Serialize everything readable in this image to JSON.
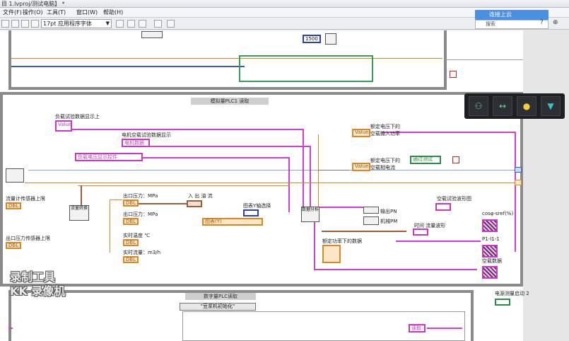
{
  "window": {
    "title": "目 1.lvproj/测试电脑】 *"
  },
  "menu": {
    "items": [
      "文件(F)",
      "操作(O)",
      "工具(T)",
      "窗口(W)",
      "帮助(H)"
    ]
  },
  "toolbar": {
    "font_select": "17pt 应用程序字体",
    "cloud_button": "连接上云",
    "help_search": "搜索",
    "window_controls": [
      "?",
      "⊕"
    ]
  },
  "top_frame": {
    "constant_value": "1500",
    "constant_color": "#2b3fb3"
  },
  "mid_frame": {
    "label": "模拟量PLC1 读取",
    "labels": {
      "load_data_display": "负载试验数据显示上",
      "motor_noload_data": "电机空载试验数据显示",
      "flowmeter_upper": "流量计传感器上限",
      "outlet_pressure_upper": "出口压力传感器上限",
      "outlet_pressure_1": "出口压力：MPa",
      "outlet_pressure_2": "出口压力：MPa",
      "realtime_temp": "实时温度 ℃",
      "realtime_flow": "实时流量：m3/h",
      "in_out_flow": "入 出 油 流",
      "chart_y_select": "图表Y轴选择",
      "rated_voltage_input": "额定电压下的",
      "noload_input_power": "空载输入功率",
      "rated_voltage_current": "额定电压下的",
      "noload_phase_current": "空载相电流",
      "noload_curve": "空载试验波形图",
      "output_power": "输出PN",
      "mech_power": "机械PM",
      "time_flow": "时间 流量波形",
      "cos_ref": "cosφ-sref(%)",
      "p1_i1": "P1-I1-1",
      "noload_data": "空载数据",
      "rated_power_data": "额定功率下的数据",
      "save_label": "保存路径",
      "analysis_node": "数据分析",
      "convert_node": "流量转换",
      "calc_node": "计算"
    },
    "controls": {
      "value_1": "Value",
      "value_2": "Value",
      "value_3": "Value",
      "load_test_ctrl": "负载电压显示控件",
      "ring_ctrl": "电机数据",
      "ring_ctrl_2": "图表(Y)",
      "bool_ctrl": "通过测试",
      "dbl": "DBL"
    }
  },
  "bottom_frame": {
    "label": "数字量PLC读取",
    "selector": "\"豆浆机初始化\"",
    "read_ctrl": "读取"
  },
  "right_side": {
    "motor_start_label": "电源测量启动 2"
  },
  "watermark": {
    "line1": "录制工具",
    "line2": "KK 录像机"
  },
  "palette": {
    "icons": [
      "network-icon",
      "arrows-icon",
      "lightbulb-icon",
      "tshirt-icon"
    ]
  }
}
